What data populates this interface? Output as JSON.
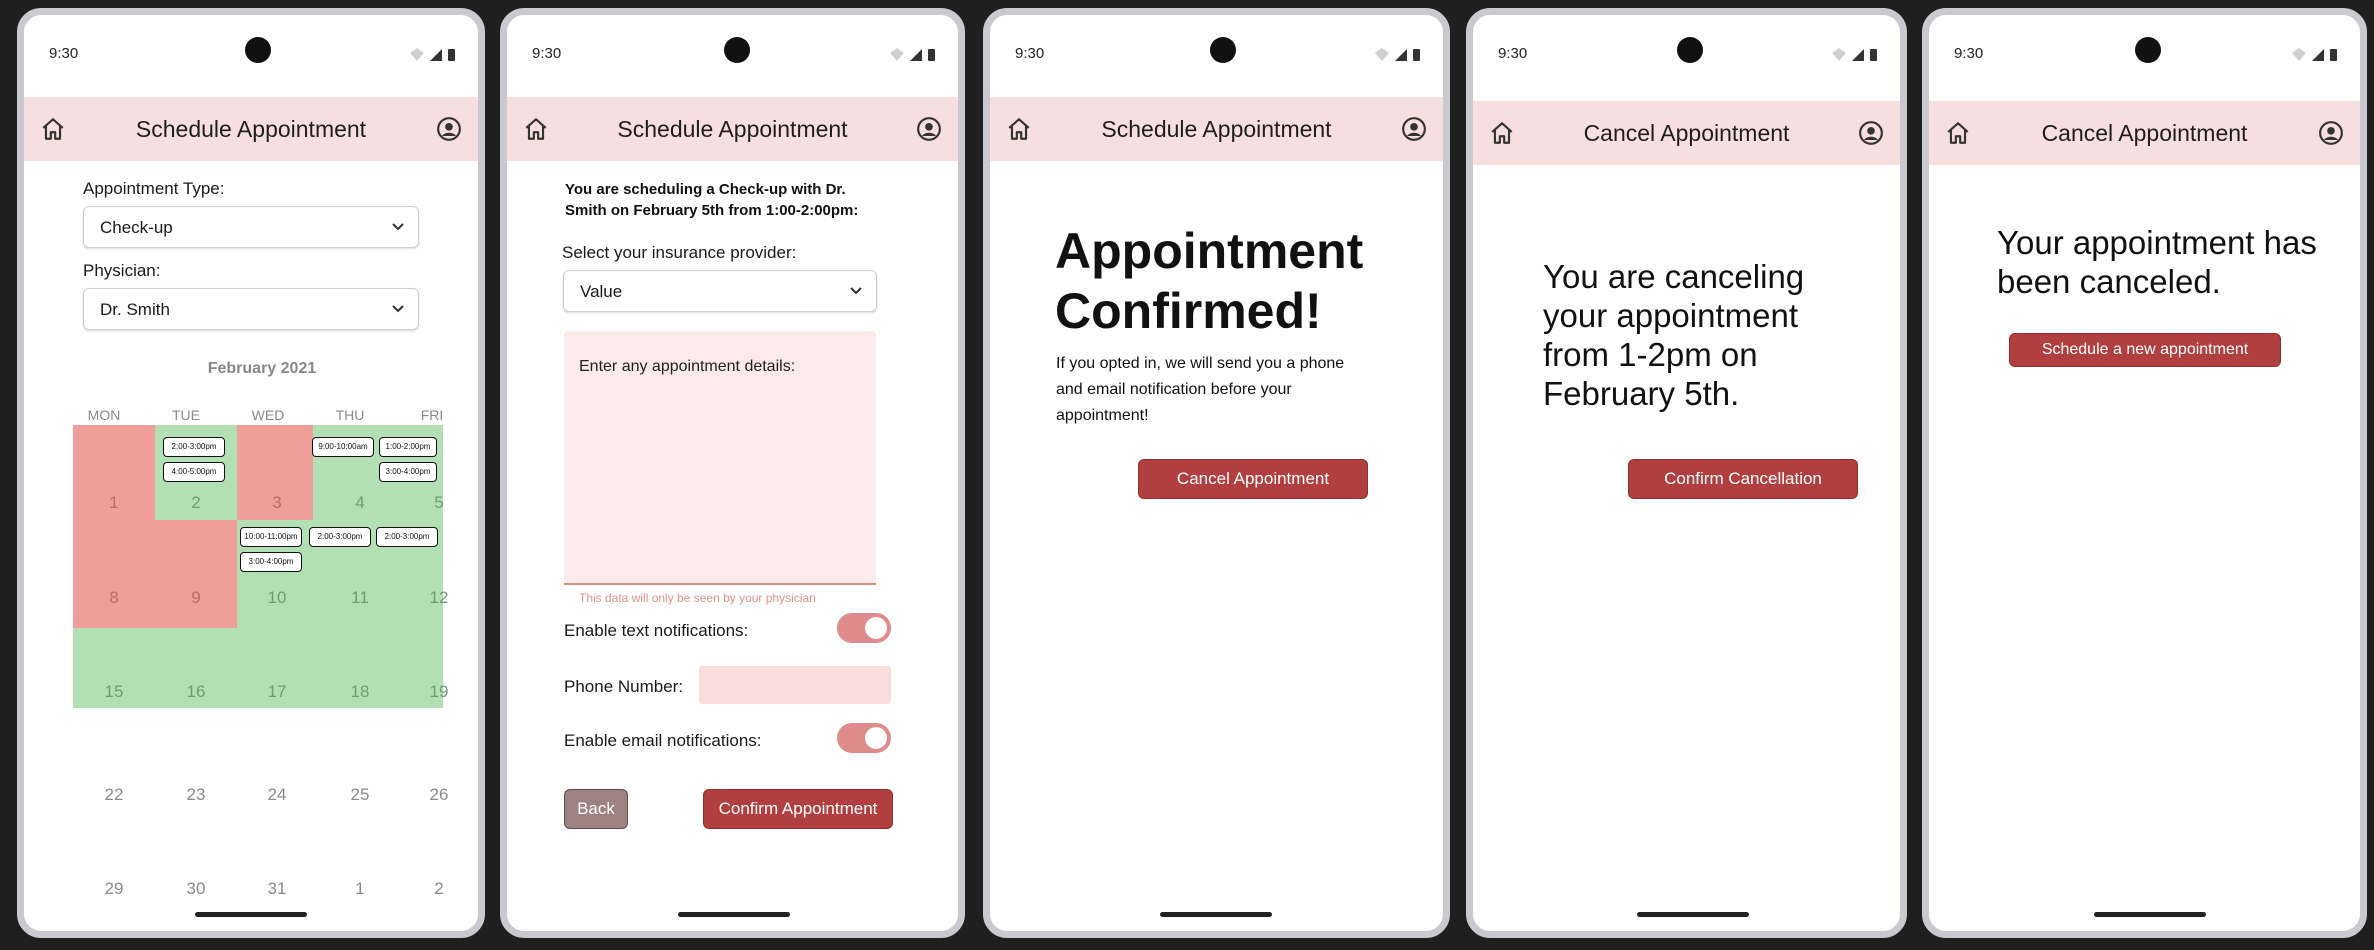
{
  "status_time": "9:30",
  "colors": {
    "appbar": "#f8dfdf",
    "booked": "#ef9e9a",
    "available": "#b3dfb4",
    "accent": "#b23f3f"
  },
  "screen1": {
    "title": "Schedule Appointment",
    "appt_type_label": "Appointment Type:",
    "appt_type_value": "Check-up",
    "physician_label": "Physician:",
    "physician_value": "Dr. Smith",
    "calendar": {
      "month": "February 2021",
      "weekdays": [
        "MON",
        "TUE",
        "WED",
        "THU",
        "FRI"
      ],
      "weeks": [
        [
          "1",
          "2",
          "3",
          "4",
          "5"
        ],
        [
          "8",
          "9",
          "10",
          "11",
          "12"
        ],
        [
          "15",
          "16",
          "17",
          "18",
          "19"
        ],
        [
          "22",
          "23",
          "24",
          "25",
          "26"
        ],
        [
          "29",
          "30",
          "31",
          "1",
          "2"
        ]
      ],
      "slots": {
        "tue2_a": "2:00-3:00pm",
        "tue2_b": "4:00-5:00pm",
        "thu4": "9:00-10:00am",
        "fri5_a": "1:00-2:00pm",
        "fri5_b": "3:00-4:00pm",
        "wed10_a": "10:00-11:00pm",
        "wed10_b": "3:00-4:00pm",
        "thu11": "2:00-3:00pm",
        "fri12": "2:00-3:00pm"
      }
    }
  },
  "screen2": {
    "title": "Schedule Appointment",
    "summary": "You are scheduling a Check-up with Dr. Smith on February 5th from 1:00-2:00pm:",
    "insurance_label": "Select your insurance provider:",
    "insurance_value": "Value",
    "details_label": "Enter any appointment details:",
    "details_helper": "This data will only be seen by your physician",
    "text_notif_label": "Enable text notifications:",
    "phone_label": "Phone Number:",
    "email_notif_label": "Enable email notifications:",
    "back_label": "Back",
    "confirm_label": "Confirm Appointment"
  },
  "screen3": {
    "title": "Schedule Appointment",
    "heading": "Appointment Confirmed!",
    "body": "If you opted in, we will send you a phone and email notification before your appointment!",
    "cancel_label": "Cancel Appointment"
  },
  "screen4": {
    "title": "Cancel Appointment",
    "body": "You are canceling your appointment from 1-2pm on February 5th.",
    "confirm_label": "Confirm Cancellation"
  },
  "screen5": {
    "title": "Cancel Appointment",
    "body": "Your appointment has been canceled.",
    "new_label": "Schedule a new appointment"
  }
}
